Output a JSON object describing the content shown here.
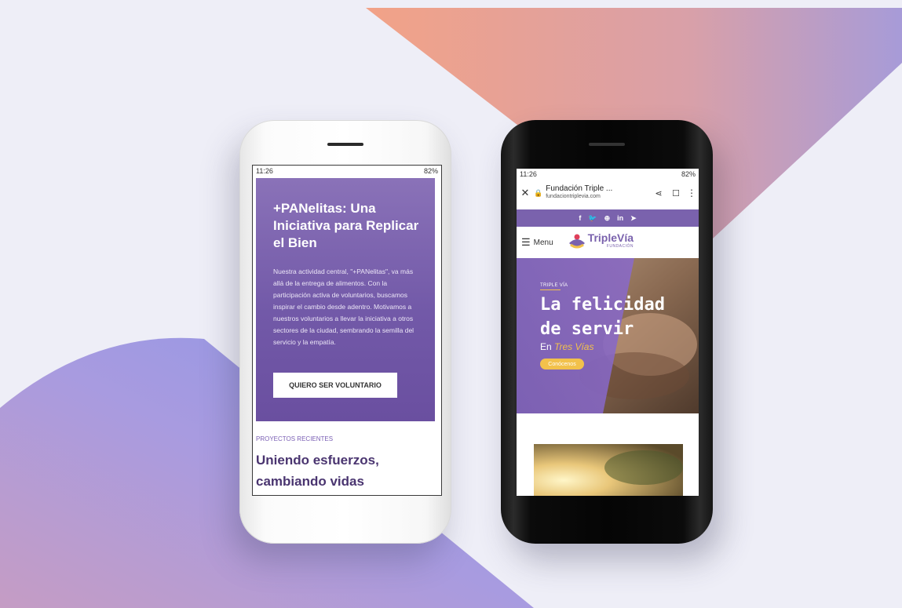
{
  "theme": {
    "purple": "#7a62ad",
    "dark_purple": "#4a3570",
    "accent_yellow": "#f2c14b",
    "bg_peach": "#f0a48a",
    "bg_lavender": "#a79ad6",
    "bg_light": "#eeeef7"
  },
  "white_phone": {
    "status": {
      "time": "11:26",
      "right": "82%"
    },
    "hero": {
      "title": "+PANelitas: Una Iniciativa para Replicar el Bien",
      "body": "Nuestra actividad central, \"+PANelitas\", va más allá de la entrega de alimentos. Con la participación activa de voluntarios, buscamos inspirar el cambio desde adentro. Motivamos a nuestros voluntarios a llevar la iniciativa a otros sectores de la ciudad, sembrando la semilla del servicio y la empatía.",
      "button": "QUIERO SER VOLUNTARIO"
    },
    "projects": {
      "label": "PROYECTOS RECIENTES",
      "title": "Uniendo esfuerzos, cambiando vidas"
    }
  },
  "black_phone": {
    "status": {
      "time": "11:26",
      "right": "82%"
    },
    "browser": {
      "page_title": "Fundación Triple ...",
      "url": "fundaciontriplevia.com"
    },
    "social": [
      "f",
      "🐦",
      "⊕",
      "in",
      "➤"
    ],
    "nav": {
      "menu_label": "Menu",
      "logo_main": "TripleVía",
      "logo_sub": "FUNDACIÓN"
    },
    "hero": {
      "tag": "TRIPLE VÍA",
      "title_line1": "La felicidad",
      "title_line2": "de servir",
      "sub_prefix": "En ",
      "sub_highlight": "Tres Vías",
      "pill": "Conócenos"
    }
  }
}
